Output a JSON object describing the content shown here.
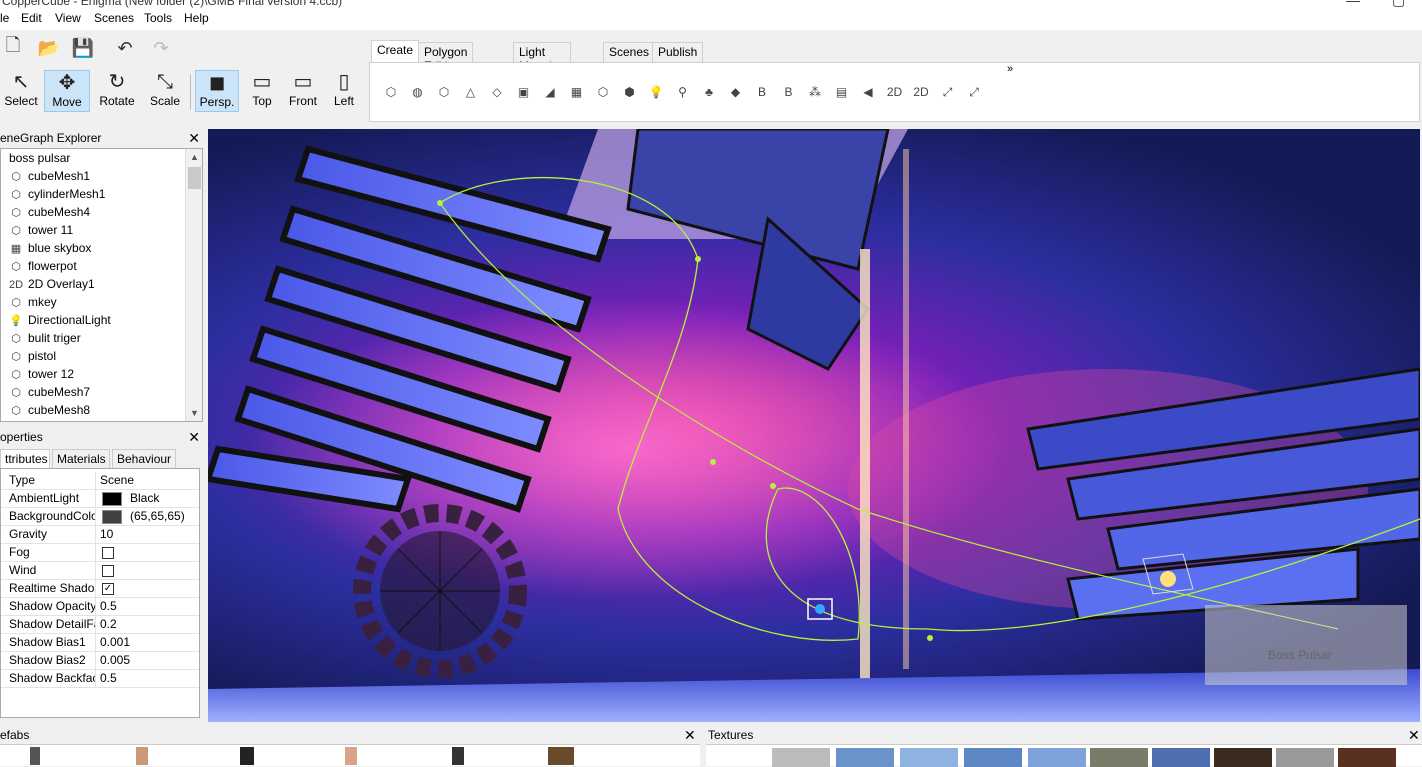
{
  "window": {
    "title": "CopperCube - Enigma (New folder (2)\\GMB Final version 4.ccb)"
  },
  "menu": [
    "le",
    "Edit",
    "View",
    "Scenes",
    "Tools",
    "Help"
  ],
  "toolbar": {
    "file_icons": [
      "new-file-icon",
      "open-folder-icon",
      "save-icon",
      "undo-icon",
      "redo-icon"
    ],
    "tools": [
      {
        "label": "Select",
        "icon": "↖",
        "active": false
      },
      {
        "label": "Move",
        "icon": "✥",
        "active": true
      },
      {
        "label": "Rotate",
        "icon": "↻",
        "active": false
      },
      {
        "label": "Scale",
        "icon": "⤡",
        "active": false
      }
    ],
    "views": [
      {
        "label": "Persp.",
        "icon": "◼",
        "active": true
      },
      {
        "label": "Top",
        "icon": "▭",
        "active": false
      },
      {
        "label": "Front",
        "icon": "▭",
        "active": false
      },
      {
        "label": "Left",
        "icon": "▯",
        "active": false
      }
    ]
  },
  "ribbon": {
    "tabs": [
      "Create",
      "Polygon Editing",
      "Light Mapping",
      "Scenes",
      "Publish"
    ],
    "active_tab": "Create",
    "more": "»",
    "icons": [
      "cube-icon",
      "sphere-icon",
      "cylinder-icon",
      "cone-icon",
      "plane-icon",
      "camera-icon",
      "terrain-icon",
      "skybox-icon",
      "mesh-icon",
      "mesh2-icon",
      "light-icon",
      "search-light-icon",
      "tree-icon",
      "water-icon",
      "billboard-icon",
      "billboard2-icon",
      "particle-icon",
      "image-icon",
      "sound-icon",
      "overlay-2d-icon",
      "overlay-2d-round-icon",
      "path-icon",
      "path2-icon"
    ],
    "icon_text": [
      "⬡",
      "◍",
      "⬡",
      "△",
      "◇",
      "▣",
      "◢",
      "▦",
      "⬡",
      "⬢",
      "💡",
      "⚲",
      "♣",
      "◆",
      "B",
      "B",
      "⁂",
      "▤",
      "◀",
      "2D",
      "2D",
      "⤢",
      "⤢"
    ]
  },
  "scene_explorer": {
    "title": "eneGraph Explorer",
    "close": "✕",
    "root": "boss pulsar",
    "items": [
      {
        "label": "cubeMesh1",
        "icon": "⬡"
      },
      {
        "label": "cylinderMesh1",
        "icon": "⬡"
      },
      {
        "label": "cubeMesh4",
        "icon": "⬡"
      },
      {
        "label": "tower 11",
        "icon": "⬡"
      },
      {
        "label": "blue skybox",
        "icon": "▦"
      },
      {
        "label": "flowerpot",
        "icon": "⬡"
      },
      {
        "label": "2D Overlay1",
        "icon": "2D"
      },
      {
        "label": "mkey",
        "icon": "⬡"
      },
      {
        "label": "DirectionalLight",
        "icon": "💡"
      },
      {
        "label": "bulit triger",
        "icon": "⬡"
      },
      {
        "label": "pistol",
        "icon": "⬡"
      },
      {
        "label": "tower 12",
        "icon": "⬡"
      },
      {
        "label": "cubeMesh7",
        "icon": "⬡"
      },
      {
        "label": "cubeMesh8",
        "icon": "⬡"
      }
    ]
  },
  "properties": {
    "title": "operties",
    "close": "✕",
    "tabs": [
      "Attributes",
      "Materials",
      "Behaviour"
    ],
    "tab_text": [
      "ttributes",
      "Materials",
      "Behaviour"
    ],
    "rows": [
      {
        "key": "Type",
        "value": "Scene",
        "kind": "text"
      },
      {
        "key": "AmbientLight",
        "value": "Black",
        "kind": "color",
        "color": "#000000"
      },
      {
        "key": "BackgroundColo",
        "value": "(65,65,65)",
        "kind": "color",
        "color": "#414141"
      },
      {
        "key": "Gravity",
        "value": "10",
        "kind": "text"
      },
      {
        "key": "Fog",
        "value": "",
        "kind": "check",
        "checked": false
      },
      {
        "key": "Wind",
        "value": "",
        "kind": "check",
        "checked": false
      },
      {
        "key": "Realtime Shado",
        "value": "",
        "kind": "check",
        "checked": true
      },
      {
        "key": "Shadow Opacity",
        "value": "0.5",
        "kind": "text"
      },
      {
        "key": "Shadow DetailFa",
        "value": "0.2",
        "kind": "text"
      },
      {
        "key": "Shadow Bias1",
        "value": "0.001",
        "kind": "text"
      },
      {
        "key": "Shadow Bias2",
        "value": "0.005",
        "kind": "text"
      },
      {
        "key": "Shadow Backfac",
        "value": "0.5",
        "kind": "text"
      }
    ]
  },
  "viewport": {
    "overlay_label": "Boss Pulsar"
  },
  "bottom": {
    "prefabs_title": "efabs",
    "textures_title": "Textures",
    "close": "✕"
  },
  "colors": {
    "accent": "#cce4f7",
    "path": "#b8f03a"
  }
}
